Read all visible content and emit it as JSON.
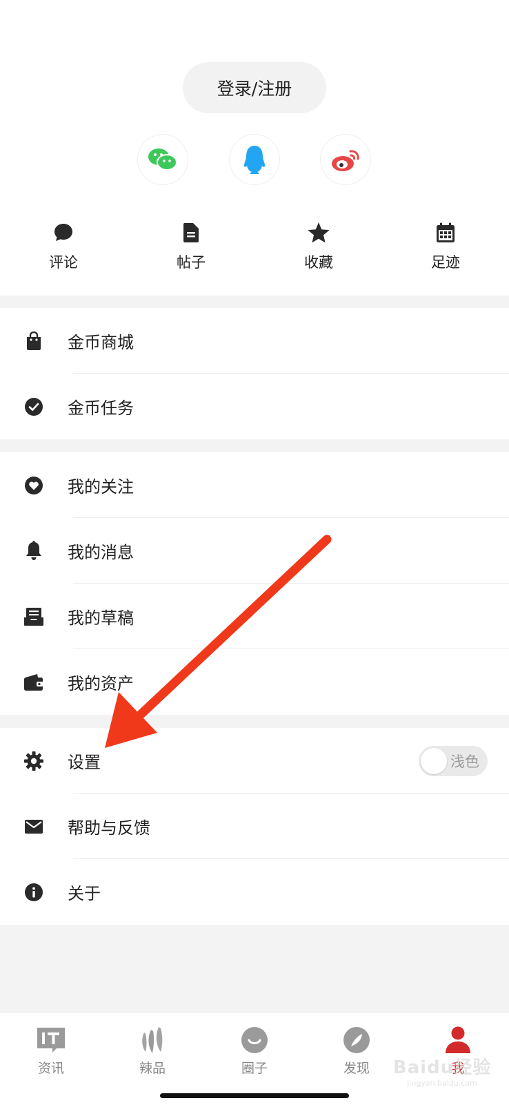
{
  "header": {
    "login_label": "登录/注册",
    "social": [
      {
        "name": "wechat-icon"
      },
      {
        "name": "qq-icon"
      },
      {
        "name": "weibo-icon"
      }
    ]
  },
  "quick": [
    {
      "label": "评论",
      "icon": "comment-icon"
    },
    {
      "label": "帖子",
      "icon": "document-icon"
    },
    {
      "label": "收藏",
      "icon": "star-icon"
    },
    {
      "label": "足迹",
      "icon": "calendar-icon"
    }
  ],
  "menu": {
    "group1": [
      {
        "label": "金币商城",
        "icon": "shopping-bag-icon"
      },
      {
        "label": "金币任务",
        "icon": "check-circle-icon"
      }
    ],
    "group2": [
      {
        "label": "我的关注",
        "icon": "heart-circle-icon"
      },
      {
        "label": "我的消息",
        "icon": "bell-icon"
      },
      {
        "label": "我的草稿",
        "icon": "inbox-icon"
      },
      {
        "label": "我的资产",
        "icon": "wallet-icon"
      }
    ],
    "group3": [
      {
        "label": "设置",
        "icon": "gear-icon",
        "toggle_label": "浅色"
      },
      {
        "label": "帮助与反馈",
        "icon": "mail-icon"
      },
      {
        "label": "关于",
        "icon": "info-icon"
      }
    ]
  },
  "tabbar": [
    {
      "label": "资讯",
      "icon": "news-icon",
      "active": false
    },
    {
      "label": "辣品",
      "icon": "chili-icon",
      "active": false
    },
    {
      "label": "圈子",
      "icon": "circle-icon",
      "active": false
    },
    {
      "label": "发现",
      "icon": "compass-icon",
      "active": false
    },
    {
      "label": "我",
      "icon": "person-icon",
      "active": true
    }
  ],
  "watermark": {
    "line1": "Baidu经验",
    "line2": "jingyan.baidu.com"
  },
  "colors": {
    "accent": "#d32b2b",
    "arrow": "#f0391b",
    "wechat": "#3ec75b",
    "qq": "#23a6f2",
    "weibo": "#e84646"
  }
}
